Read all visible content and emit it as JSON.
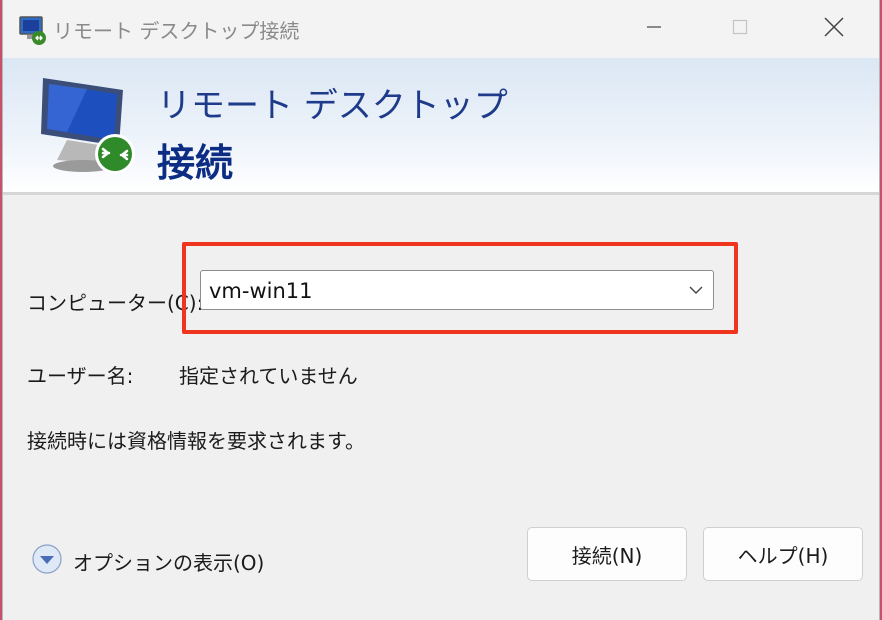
{
  "window": {
    "title": "リモート デスクトップ接続"
  },
  "banner": {
    "line1": "リモート デスクトップ",
    "line2": "接続"
  },
  "form": {
    "computer_label": "コンピューター(C):",
    "computer_value": "vm-win11",
    "user_label": "ユーザー名:",
    "user_value": "指定されていません",
    "info_text": "接続時には資格情報を要求されます。"
  },
  "options": {
    "label": "オプションの表示(O)"
  },
  "buttons": {
    "connect": "接続(N)",
    "help": "ヘルプ(H)"
  },
  "colors": {
    "highlight": "#f0351f",
    "banner_text": "#0c2d83"
  },
  "icons": {
    "app": "remote-desktop-icon",
    "minimize": "minimize-icon",
    "maximize": "maximize-icon",
    "close": "close-icon",
    "dropdown": "chevron-down-icon",
    "options": "expand-options-icon"
  }
}
